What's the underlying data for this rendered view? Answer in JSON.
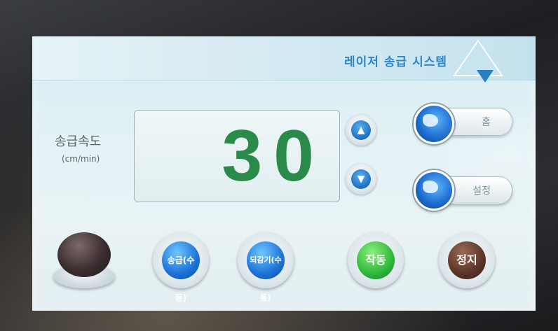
{
  "header": {
    "title": "레이저 송급 시스템"
  },
  "speed": {
    "label": "송급속도",
    "unit": "(cm/min)",
    "value": "30"
  },
  "controls": {
    "up_icon": "chevron-up-icon",
    "down_icon": "chevron-down-icon",
    "home_label": "홈",
    "settings_label": "설정"
  },
  "bottom_buttons": {
    "feed_manual": "송급(수동)",
    "rewind_manual": "되감기(수동)",
    "start": "작동",
    "stop": "정지"
  },
  "colors": {
    "title": "#2d86c9",
    "value": "#2a8a4a",
    "blue_button": "#1c73d6",
    "start_button": "#2fb83a",
    "stop_button": "#5a3428"
  }
}
